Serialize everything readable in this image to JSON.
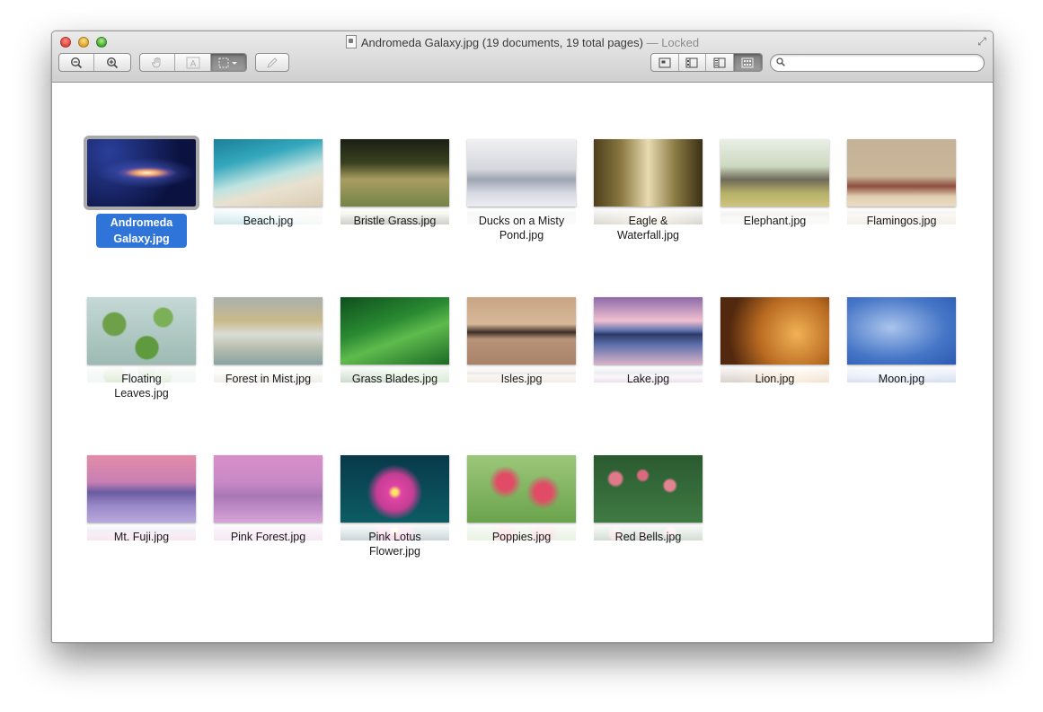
{
  "window": {
    "title": "Andromeda Galaxy.jpg (19 documents, 19 total pages)",
    "title_suffix": "— Locked"
  },
  "toolbar": {
    "zoom_out": "zoom-out-icon",
    "zoom_in": "zoom-in-icon",
    "tools": [
      "hand-icon",
      "text-select-icon",
      "rect-select-icon"
    ],
    "annotate": "pencil-icon",
    "views": [
      "content-only-icon",
      "thumbnails-view-icon",
      "sidebar-view-icon",
      "contact-sheet-icon"
    ],
    "active_view": "contact-sheet",
    "search": {
      "placeholder": "",
      "value": ""
    }
  },
  "images": [
    {
      "name": "Andromeda Galaxy.jpg",
      "line1": "Andromeda",
      "line2": "Galaxy.jpg",
      "selected": true
    },
    {
      "name": "Beach.jpg",
      "line1": "Beach.jpg"
    },
    {
      "name": "Bristle Grass.jpg",
      "line1": "Bristle Grass.jpg"
    },
    {
      "name": "Ducks on a Misty Pond.jpg",
      "line1": "Ducks on a Misty",
      "line2": "Pond.jpg"
    },
    {
      "name": "Eagle & Waterfall.jpg",
      "line1": "Eagle &",
      "line2": "Waterfall.jpg"
    },
    {
      "name": "Elephant.jpg",
      "line1": "Elephant.jpg"
    },
    {
      "name": "Flamingos.jpg",
      "line1": "Flamingos.jpg"
    },
    {
      "name": "Floating Leaves.jpg",
      "line1": "Floating",
      "line2": "Leaves.jpg"
    },
    {
      "name": "Forest in Mist.jpg",
      "line1": "Forest in Mist.jpg"
    },
    {
      "name": "Grass Blades.jpg",
      "line1": "Grass Blades.jpg"
    },
    {
      "name": "Isles.jpg",
      "line1": "Isles.jpg"
    },
    {
      "name": "Lake.jpg",
      "line1": "Lake.jpg"
    },
    {
      "name": "Lion.jpg",
      "line1": "Lion.jpg"
    },
    {
      "name": "Moon.jpg",
      "line1": "Moon.jpg"
    },
    {
      "name": "Mt. Fuji.jpg",
      "line1": "Mt. Fuji.jpg"
    },
    {
      "name": "Pink Forest.jpg",
      "line1": "Pink Forest.jpg"
    },
    {
      "name": "Pink Lotus Flower.jpg",
      "line1": "Pink Lotus",
      "line2": "Flower.jpg"
    },
    {
      "name": "Poppies.jpg",
      "line1": "Poppies.jpg"
    },
    {
      "name": "Red Bells.jpg",
      "line1": "Red Bells.jpg"
    }
  ],
  "colors": {
    "selection": "#2f74d8",
    "selection_outline": "#a9a9a9"
  }
}
